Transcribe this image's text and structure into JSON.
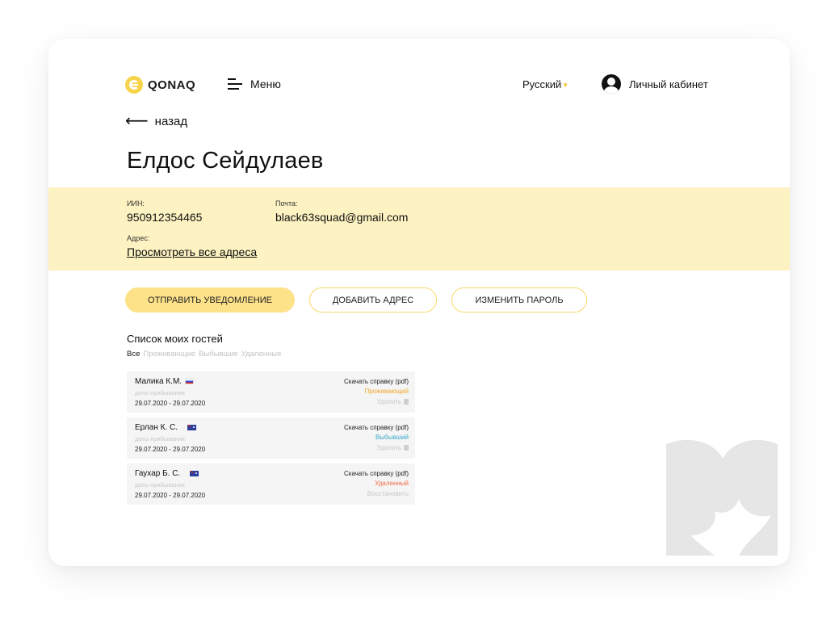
{
  "header": {
    "logo_prefix": "e",
    "logo_text": "QONAQ",
    "menu_label": "Меню",
    "language": "Русский",
    "account_label": "Личный кабинет"
  },
  "back_label": "назад",
  "user": {
    "name": "Елдос Сейдулаев",
    "iin_label": "ИИН:",
    "iin": "950912354465",
    "email_label": "Почта:",
    "email": "black63squad@gmail.com",
    "address_label": "Адрес:",
    "address_link": "Просмотреть все адреса"
  },
  "actions": {
    "notify": "ОТПРАВИТЬ УВЕДОМЛЕНИЕ",
    "add_address": "ДОБАВИТЬ АДРЕС",
    "change_password": "ИЗМЕНИТЬ ПАРОЛЬ"
  },
  "guests": {
    "title": "Список моих гостей",
    "filters": [
      "Все",
      "Проживающие",
      "Выбывшие",
      "Удаленные"
    ],
    "items": [
      {
        "name": "Малика К.М.",
        "flag": "russia-flag-icon",
        "dates_label": "даты прибывания",
        "dates": "29.07.2020 - 29.07.2020",
        "pdf": "Скачать справку (pdf)",
        "status": "Проживающий",
        "status_color": "#f0a62e",
        "action": "Удалить"
      },
      {
        "name": "Ерлан К. С.",
        "flag": "australia-flag-icon",
        "dates_label": "даты прибывания",
        "dates": "29.07.2020 - 29.07.2020",
        "pdf": "Скачать справку (pdf)",
        "status": "Выбывший",
        "status_color": "#3aa9c9",
        "action": "Удалить"
      },
      {
        "name": "Гаухар Б. С.",
        "flag": "australia-flag-icon",
        "dates_label": "даты прибывания",
        "dates": "29.07.2020 - 29.07.2020",
        "pdf": "Скачать справку (pdf)",
        "status": "Удаленный",
        "status_color": "#ef6b4a",
        "action": "Восстановить"
      }
    ]
  }
}
